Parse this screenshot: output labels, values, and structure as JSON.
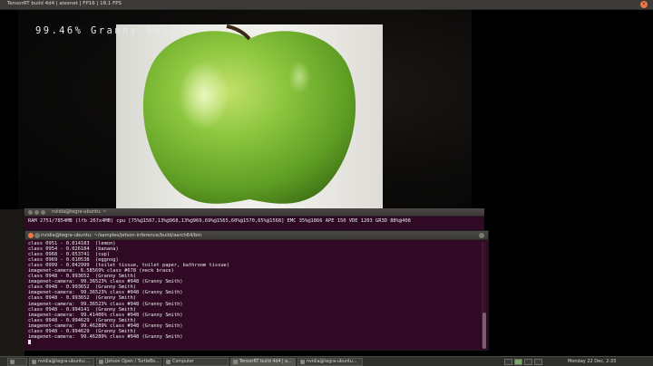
{
  "window": {
    "title": "TensorRT build 4d4 | alexnet | FP16 | 18.1 FPS"
  },
  "overlay": {
    "text": "99.46% Granny Smith"
  },
  "tegrastats_terminal": {
    "title": "nvidia@tegra-ubuntu: ~",
    "line": "RAM 2751/7854MB (lfb 267x4MB) cpu [75%@1567,13%@968,13%@969,69%@1565,60%@1570,65%@1568] EMC 35%@1866 APE 150 VDE 1203 GR3D 88%@408"
  },
  "imagenet_terminal": {
    "title": "nvidia@tegra-ubuntu: ~/samples/jetson-inference/build/aarch64/bin",
    "lines": [
      "class 0951 - 0.014183  (lemon)",
      "class 0954 - 0.026184  (banana)",
      "class 0968 - 0.053741  (cup)",
      "class 0969 - 0.010538  (eggnog)",
      "class 0999 - 0.042999  (toilet tissue, toilet paper, bathroom tissue)",
      "imagenet-camera:  6.58569% class #678 (neck brace)",
      "class 0948 - 0.993652  (Granny Smith)",
      "imagenet-camera:  99.36523% class #948 (Granny Smith)",
      "class 0948 - 0.993652  (Granny Smith)",
      "imagenet-camera:  99.36523% class #948 (Granny Smith)",
      "class 0948 - 0.993652  (Granny Smith)",
      "imagenet-camera:  99.36523% class #948 (Granny Smith)",
      "class 0948 - 0.994141  (Granny Smith)",
      "imagenet-camera:  99.41406% class #948 (Granny Smith)",
      "class 0948 - 0.994629  (Granny Smith)",
      "imagenet-camera:  99.46289% class #948 (Granny Smith)",
      "class 0948 - 0.994629  (Granny Smith)",
      "imagenet-camera:  99.46289% class #948 (Granny Smith)"
    ]
  },
  "taskbar": {
    "tasks": [
      {
        "label": "nvidia@tegra-ubuntu:..."
      },
      {
        "label": "[Jetson Open / TurtleBo..."
      },
      {
        "label": "Computer"
      },
      {
        "label": "TensorRT build 4d4 | a..."
      },
      {
        "label": "nvidia@tegra-ubuntu..."
      }
    ],
    "clock": "Monday 22 Dec, 2:33"
  },
  "colors": {
    "terminal_bg": "#300a24",
    "panel_bg": "#3c3b37",
    "apple_green": "#7fbe3a"
  }
}
